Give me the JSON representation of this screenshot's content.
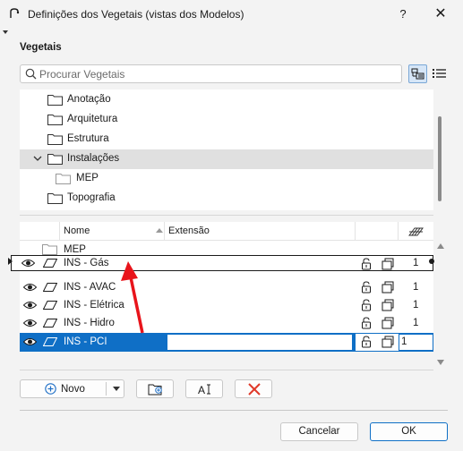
{
  "window": {
    "title": "Definições dos Vegetais (vistas dos Modelos)",
    "help_label": "?",
    "close_label": "✕"
  },
  "section": {
    "label": "Vegetais"
  },
  "search": {
    "placeholder": "Procurar Vegetais",
    "value": ""
  },
  "view_toggle": {
    "selected": "tree-view"
  },
  "tree": {
    "items": [
      {
        "label": "Anotação",
        "level": 0,
        "expanded": false,
        "selected": false
      },
      {
        "label": "Arquitetura",
        "level": 0,
        "expanded": false,
        "selected": false
      },
      {
        "label": "Estrutura",
        "level": 0,
        "expanded": false,
        "selected": false
      },
      {
        "label": "Instalações",
        "level": 0,
        "expanded": true,
        "selected": true
      },
      {
        "label": "MEP",
        "level": 1,
        "expanded": false,
        "selected": false
      },
      {
        "label": "Topografia",
        "level": 0,
        "expanded": false,
        "selected": false
      }
    ]
  },
  "table": {
    "columns": {
      "name": "Nome",
      "extension": "Extensão"
    },
    "folder_row": {
      "label": "MEP"
    },
    "rows": [
      {
        "name": "INS - Gás",
        "number": "1",
        "dragging": true
      },
      {
        "name": "INS - AVAC",
        "number": "1"
      },
      {
        "name": "INS - Elétrica",
        "number": "1"
      },
      {
        "name": "INS - Hidro",
        "number": "1"
      },
      {
        "name": "INS - PCI",
        "number": "1",
        "selected": true
      }
    ]
  },
  "toolbar": {
    "new_label": "Novo"
  },
  "footer": {
    "cancel_label": "Cancelar",
    "ok_label": "OK"
  },
  "colors": {
    "accent": "#0f6fc6",
    "arrow": "#e8141b",
    "delete": "#e03a2a"
  }
}
